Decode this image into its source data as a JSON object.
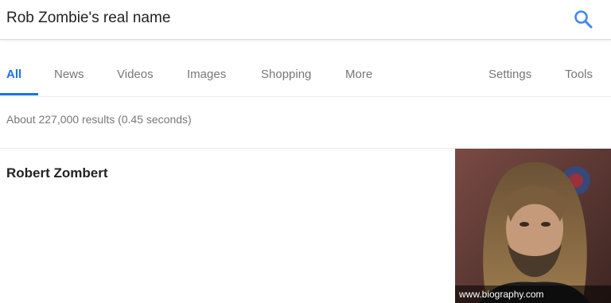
{
  "search": {
    "query": "Rob Zombie's real name",
    "icon": "search-icon"
  },
  "tabs": [
    {
      "label": "All",
      "active": true
    },
    {
      "label": "News"
    },
    {
      "label": "Videos"
    },
    {
      "label": "Images"
    },
    {
      "label": "Shopping"
    },
    {
      "label": "More"
    },
    {
      "label": "Settings"
    },
    {
      "label": "Tools"
    }
  ],
  "colors": {
    "accent": "#1a73e8",
    "tab_text": "#777777",
    "title_text": "#222222"
  },
  "results": {
    "stats": "About 227,000 results (0.45 seconds)"
  },
  "answer": {
    "title": "Robert Zombert",
    "image_source": "www.biography.com"
  }
}
